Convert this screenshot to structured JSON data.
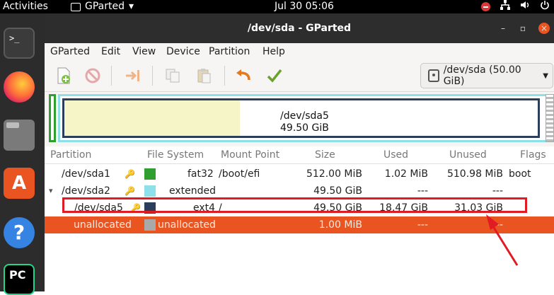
{
  "topbar": {
    "activities": "Activities",
    "app_name": "GParted",
    "app_menu_arrow": "▾",
    "clock": "Jul 30  05:06",
    "tray_icons": [
      "stop-icon",
      "network-icon",
      "volume-icon",
      "power-icon"
    ]
  },
  "dock": {
    "items": [
      "terminal",
      "firefox",
      "files",
      "ubuntu-software",
      "help",
      "pycharm"
    ],
    "terminal_glyph": ">_",
    "store_glyph": "A",
    "help_glyph": "?",
    "pycharm_glyph": "PC"
  },
  "window": {
    "title": "/dev/sda - GParted",
    "controls": {
      "minimize": "–",
      "maximize": "▫",
      "close": "×"
    }
  },
  "menubar": [
    "GParted",
    "Edit",
    "View",
    "Device",
    "Partition",
    "Help"
  ],
  "toolbar": {
    "buttons": [
      "new-partition-icon",
      "delete-icon",
      "resize-move-icon",
      "copy-icon",
      "paste-icon",
      "undo-icon",
      "apply-icon"
    ],
    "device_label": "/dev/sda (50.00 GiB)",
    "colors": {
      "undo": "#e07b1f",
      "apply": "#6aa22c",
      "delete": "#d9534f"
    }
  },
  "map": {
    "label_name": "/dev/sda5",
    "label_size": "49.50 GiB",
    "used_fraction": 0.37,
    "colors": {
      "fat32": "#2fa02f",
      "extended": "#8ee0e8",
      "ext4": "#2d3e5a",
      "used": "#f5f5c8"
    }
  },
  "table": {
    "headers": [
      "Partition",
      "File System",
      "Mount Point",
      "Size",
      "Used",
      "Unused",
      "Flags"
    ],
    "rows": [
      {
        "partition": "/dev/sda1",
        "fs": "fat32",
        "mount": "/boot/efi",
        "size": "512.00 MiB",
        "used": "1.02 MiB",
        "unused": "510.98 MiB",
        "flags": "boot",
        "color": "#2fa02f"
      },
      {
        "partition": "/dev/sda2",
        "fs": "extended",
        "mount": "",
        "size": "49.50 GiB",
        "used": "---",
        "unused": "---",
        "flags": "",
        "color": "#8ee0e8",
        "expander": "▾"
      },
      {
        "partition": "/dev/sda5",
        "fs": "ext4",
        "mount": "/",
        "size": "49.50 GiB",
        "used": "18.47 GiB",
        "unused": "31.03 GiB",
        "flags": "",
        "color": "#2d3e5a"
      },
      {
        "partition": "unallocated",
        "fs": "unallocated",
        "mount": "",
        "size": "1.00 MiB",
        "used": "---",
        "unused": "---",
        "flags": "",
        "color": "#a9a9a9"
      }
    ]
  },
  "annotation": {
    "color": "#e01b24"
  }
}
